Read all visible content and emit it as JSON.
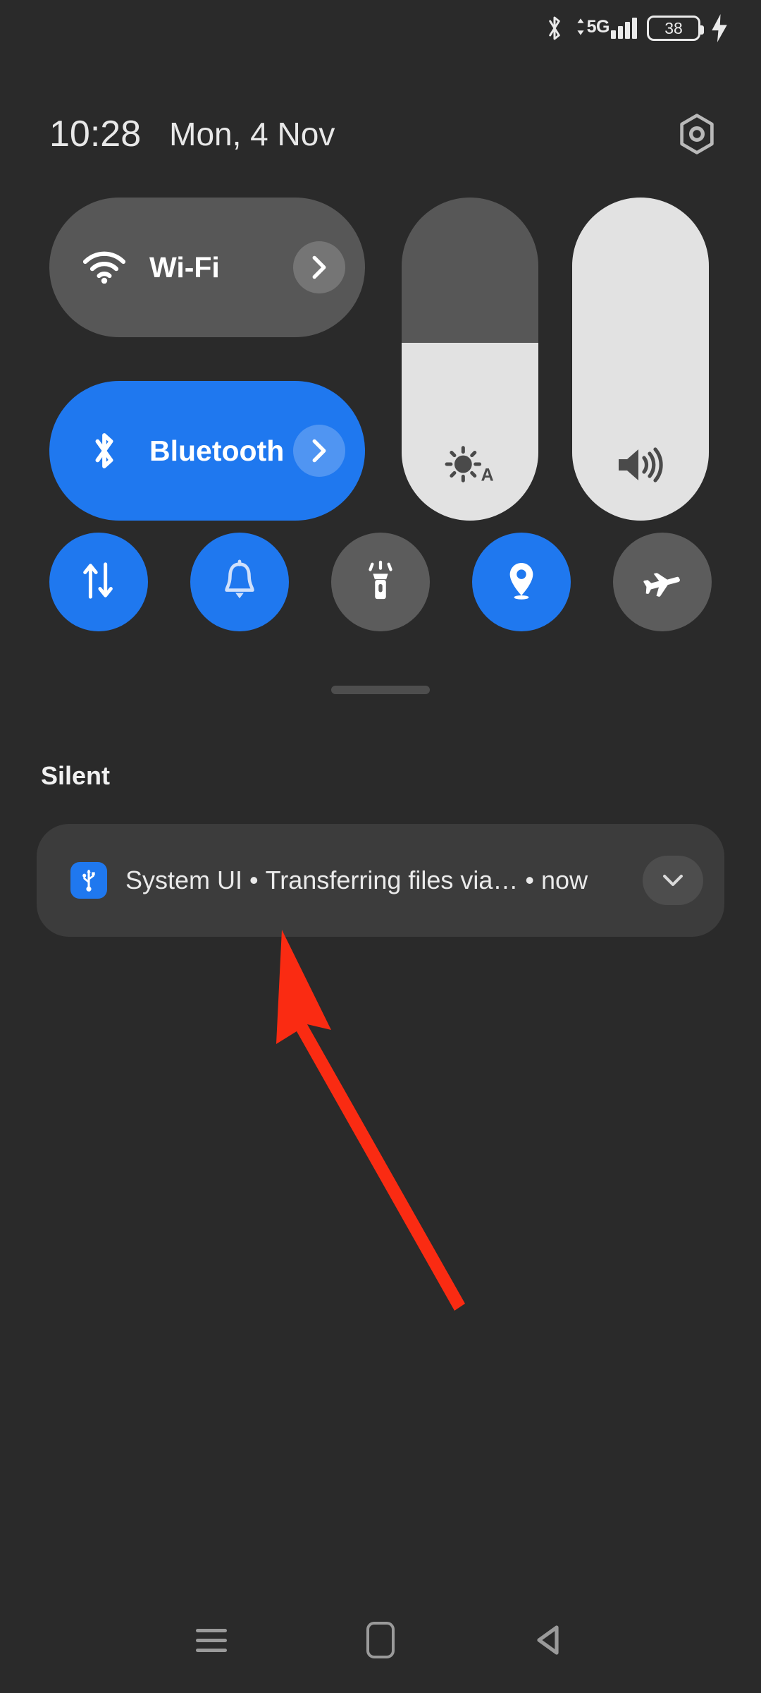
{
  "status_bar": {
    "bluetooth_icon": "bluetooth-icon",
    "network_type": "5G",
    "data_activity_icon": "data-updown-icon",
    "signal_icon": "signal-bars-icon",
    "signal_bars": 4,
    "battery_level": "38",
    "charging_icon": "charging-bolt-icon"
  },
  "header": {
    "time": "10:28",
    "date": "Mon, 4 Nov",
    "settings_icon": "settings-gear-icon"
  },
  "quick_settings": {
    "big_tiles": [
      {
        "label": "Wi-Fi",
        "icon": "wifi-icon",
        "state": "off",
        "chevron_icon": "chevron-right-icon"
      },
      {
        "label": "Bluetooth",
        "icon": "bluetooth-icon",
        "state": "on",
        "chevron_icon": "chevron-right-icon"
      }
    ],
    "sliders": [
      {
        "name": "brightness",
        "icon": "brightness-auto-icon",
        "value": 55
      },
      {
        "name": "volume",
        "icon": "volume-up-icon",
        "value": 100
      }
    ],
    "toggles": [
      {
        "name": "mobile-data",
        "icon": "data-transfer-icon",
        "state": "on"
      },
      {
        "name": "ring-mode",
        "icon": "bell-icon",
        "state": "on"
      },
      {
        "name": "flashlight",
        "icon": "flashlight-icon",
        "state": "off"
      },
      {
        "name": "location",
        "icon": "location-pin-icon",
        "state": "on"
      },
      {
        "name": "airplane-mode",
        "icon": "airplane-icon",
        "state": "off"
      }
    ],
    "drag_handle": "drag-handle"
  },
  "notifications": {
    "section_title": "Silent",
    "items": [
      {
        "app": "System UI",
        "separator": "•",
        "text": "Transferring files via…",
        "time_separator": "•",
        "time": "now",
        "icon": "usb-icon",
        "expand_icon": "chevron-down-icon"
      }
    ]
  },
  "nav_bar": {
    "recents_icon": "recents-menu-icon",
    "home_icon": "home-square-icon",
    "back_icon": "back-triangle-icon"
  },
  "annotation": {
    "arrow_icon": "red-pointer-arrow",
    "color": "#FA2B12"
  },
  "colors": {
    "background": "#2a2a2a",
    "tile_off": "#575757",
    "tile_on": "#1f78ef",
    "slider_track": "#575757",
    "slider_fill": "#e2e2e2",
    "notification_bg": "#3c3c3c",
    "text_primary": "#eaeaea"
  }
}
